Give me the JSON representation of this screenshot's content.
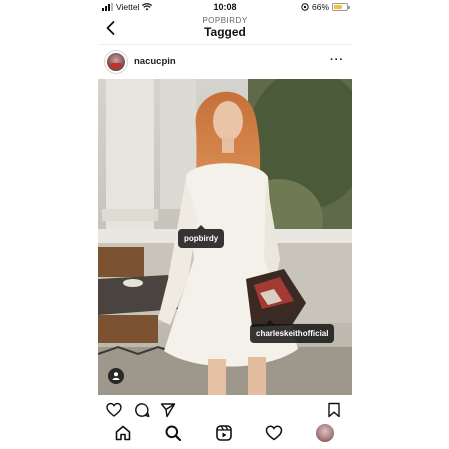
{
  "status_bar": {
    "carrier": "Viettel",
    "time": "10:08",
    "battery": "66%",
    "battery_level": 0.66
  },
  "header": {
    "subtitle": "POPBIRDY",
    "title": "Tagged"
  },
  "post": {
    "username": "nacucpin",
    "tags": [
      {
        "label": "popbirdy"
      },
      {
        "label": "charleskeithofficial"
      }
    ]
  },
  "icons": {
    "back": "chevron-left-icon",
    "more": "more-horizontal-icon",
    "like": "heart-icon",
    "comment": "comment-icon",
    "share": "send-icon",
    "save": "bookmark-icon",
    "user_tags": "user-icon",
    "nav": [
      "home-icon",
      "search-icon",
      "reels-icon",
      "activity-heart-icon",
      "profile-avatar"
    ]
  },
  "colors": {
    "battery": "#f2c230",
    "tag_bg": "#141414"
  }
}
